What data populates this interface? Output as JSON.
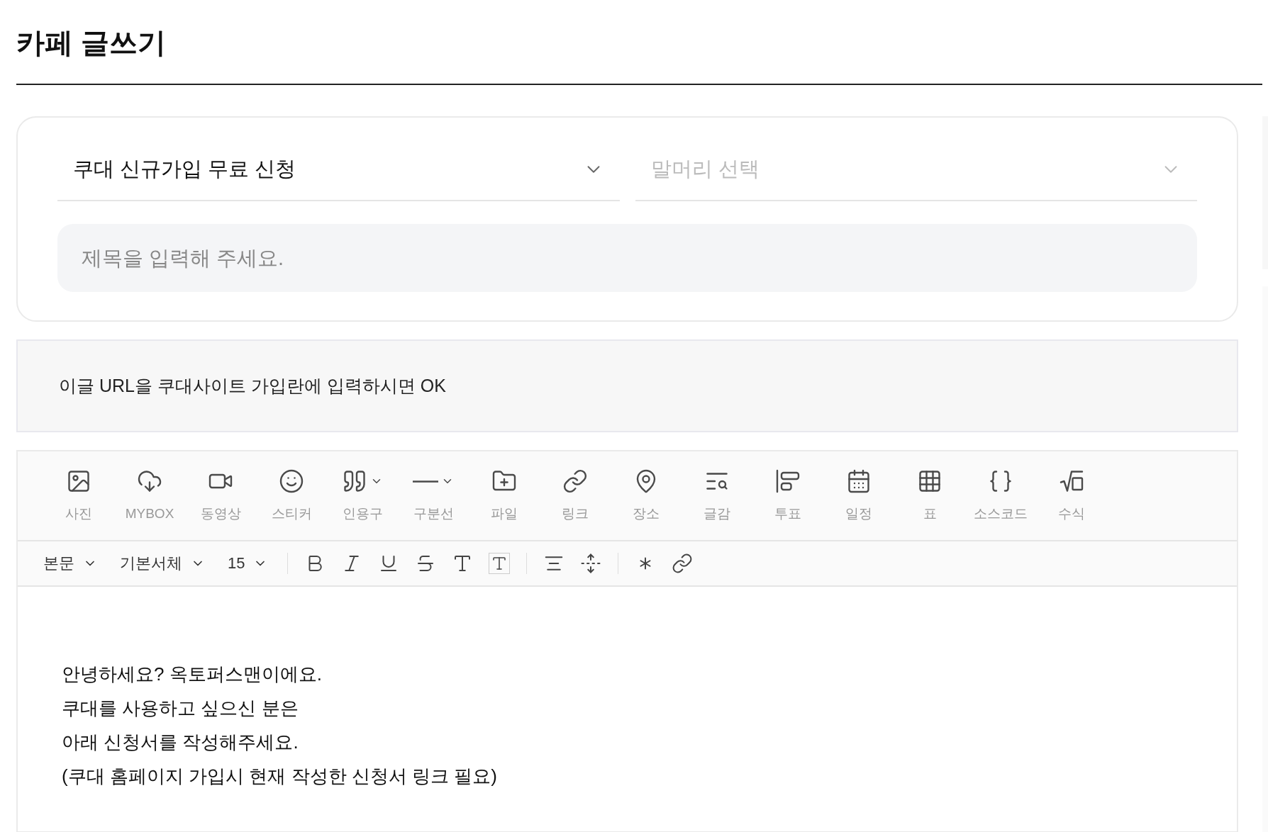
{
  "page_title": "카페 글쓰기",
  "board_select": {
    "value": "쿠대 신규가입 무료 신청"
  },
  "prefix_select": {
    "placeholder": "말머리 선택"
  },
  "title_field": {
    "placeholder": "제목을 입력해 주세요."
  },
  "notice": "이글 URL을 쿠대사이트 가입란에 입력하시면 OK",
  "insert_toolbar": [
    {
      "kind": "photo",
      "label": "사진",
      "has_menu": false
    },
    {
      "kind": "mybox",
      "label": "MYBOX",
      "has_menu": false
    },
    {
      "kind": "video",
      "label": "동영상",
      "has_menu": false
    },
    {
      "kind": "sticker",
      "label": "스티커",
      "has_menu": false
    },
    {
      "kind": "quote",
      "label": "인용구",
      "has_menu": true
    },
    {
      "kind": "divider",
      "label": "구분선",
      "has_menu": true
    },
    {
      "kind": "file",
      "label": "파일",
      "has_menu": false
    },
    {
      "kind": "link",
      "label": "링크",
      "has_menu": false
    },
    {
      "kind": "place",
      "label": "장소",
      "has_menu": false
    },
    {
      "kind": "material",
      "label": "글감",
      "has_menu": false
    },
    {
      "kind": "poll",
      "label": "투표",
      "has_menu": false
    },
    {
      "kind": "schedule",
      "label": "일정",
      "has_menu": false
    },
    {
      "kind": "table",
      "label": "표",
      "has_menu": false
    },
    {
      "kind": "code",
      "label": "소스코드",
      "has_menu": false
    },
    {
      "kind": "formula",
      "label": "수식",
      "has_menu": false
    }
  ],
  "format_toolbar": {
    "paragraph_style": "본문",
    "font": "기본서체",
    "font_size": "15"
  },
  "body": [
    "안녕하세요? 옥토퍼스맨이에요.",
    "쿠대를 사용하고 싶으신 분은",
    "아래 신청서를 작성해주세요.",
    "(쿠대 홈페이지 가입시 현재 작성한 신청서 링크 필요)"
  ]
}
